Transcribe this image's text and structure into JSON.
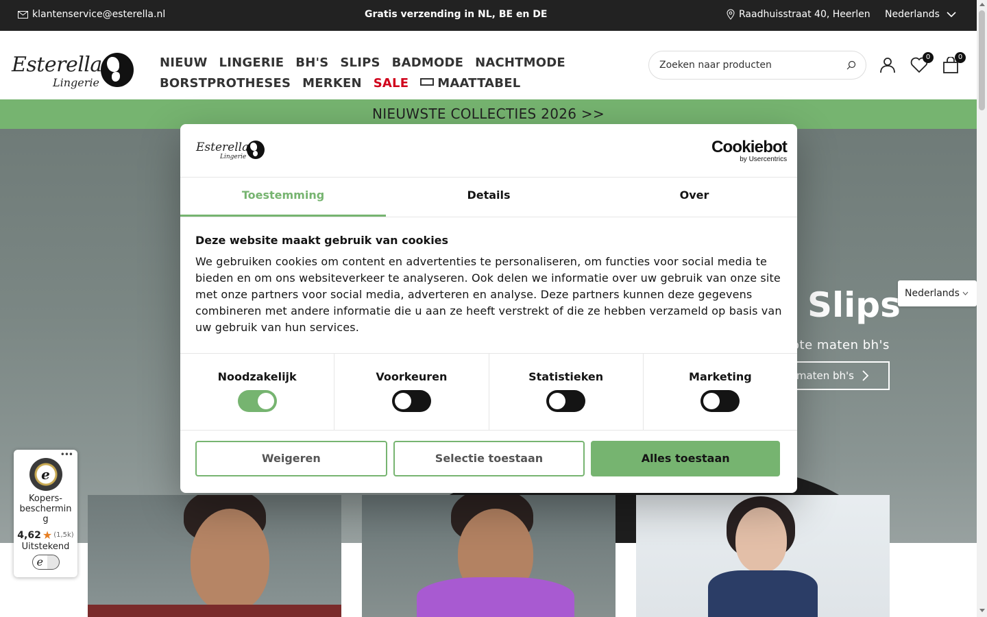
{
  "topbar": {
    "email": "klantenservice@esterella.nl",
    "shipping": "Gratis verzending in NL, BE en DE",
    "address": "Raadhuisstraat 40, Heerlen",
    "language": "Nederlands",
    "icons": [
      "mail-icon",
      "location-pin-icon",
      "chevron-down-icon"
    ]
  },
  "header": {
    "logo_word": "Esterella",
    "logo_sub": "Lingerie",
    "nav_row1": [
      "NIEUW",
      "LINGERIE",
      "BH'S",
      "SLIPS",
      "BADMODE",
      "NACHTMODE"
    ],
    "nav_row2": [
      "BORSTPROTHESES",
      "MERKEN",
      "SALE",
      "MAATTABEL"
    ],
    "search_placeholder": "Zoeken naar producten",
    "wishlist_count": "0",
    "cart_count": "0",
    "icons": [
      "search-icon",
      "user-icon",
      "heart-icon",
      "bag-icon",
      "ruler-icon"
    ]
  },
  "promo": {
    "text": "NIEUWSTE COLLECTIES 2026 >>"
  },
  "hero": {
    "title": "Slips",
    "subtitle": "ote maten bh's",
    "button_label": "e maten bh's"
  },
  "language_float": "Nederlands",
  "trusted_shops": {
    "label1": "Kopers-",
    "label2": "beschermin",
    "label3": "g",
    "score": "4,62",
    "count": "(1,5k)",
    "verdict": "Uitstekend",
    "seal_letter": "e"
  },
  "cookie_dialog": {
    "brand_word": "Esterella",
    "brand_sub": "Lingerie",
    "provider": "Cookiebot",
    "provider_sub": "by Usercentrics",
    "tabs": [
      "Toestemming",
      "Details",
      "Over"
    ],
    "active_tab": 0,
    "heading": "Deze website maakt gebruik van cookies",
    "body": "We gebruiken cookies om content en advertenties te personaliseren, om functies voor social media te bieden en om ons websiteverkeer te analyseren. Ook delen we informatie over uw gebruik van onze site met onze partners voor social media, adverteren en analyse. Deze partners kunnen deze gegevens combineren met andere informatie die u aan ze heeft verstrekt of die ze hebben verzameld op basis van uw gebruik van hun services.",
    "categories": [
      {
        "label": "Noodzakelijk",
        "on": true
      },
      {
        "label": "Voorkeuren",
        "on": false
      },
      {
        "label": "Statistieken",
        "on": false
      },
      {
        "label": "Marketing",
        "on": false
      }
    ],
    "buttons": {
      "reject": "Weigeren",
      "selection": "Selectie toestaan",
      "accept_all": "Alles toestaan"
    }
  },
  "colors": {
    "accent_green": "#76b470",
    "topbar_bg": "#222222",
    "sale_red": "#d0021b"
  }
}
